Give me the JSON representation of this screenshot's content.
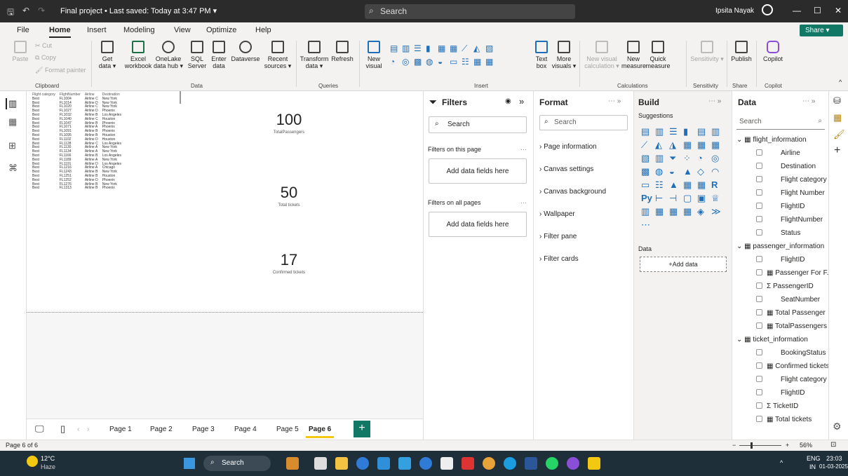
{
  "titlebar": {
    "title": "Final project • Last saved: Today at 3:47 PM ▾",
    "search": "Search",
    "user": "Ipsita Nayak"
  },
  "menu": {
    "items": [
      "File",
      "Home",
      "Insert",
      "Modeling",
      "View",
      "Optimize",
      "Help"
    ],
    "share": "Share ▾"
  },
  "ribbon": {
    "paste": "Paste",
    "cut": "Cut",
    "copy": "Copy",
    "format_painter": "Format painter",
    "get_data": "Get data ▾",
    "excel": "Excel workbook",
    "onelake": "OneLake data hub ▾",
    "sql": "SQL Server",
    "enter_data": "Enter data",
    "dataverse": "Dataverse",
    "recent": "Recent sources ▾",
    "transform": "Transform data ▾",
    "refresh": "Refresh",
    "new_visual": "New visual",
    "text_box": "Text box",
    "more_visuals": "More visuals ▾",
    "new_visual_calc": "New visual calculation ▾",
    "new_measure": "New measure",
    "quick_measure": "Quick measure",
    "sensitivity": "Sensitivity ▾",
    "publish": "Publish",
    "copilot": "Copilot",
    "groups": [
      "Clipboard",
      "Data",
      "Queries",
      "Insert",
      "Calculations",
      "Sensitivity",
      "Share",
      "Copilot"
    ]
  },
  "table": {
    "headers": [
      "Flight category",
      "FlightNumber",
      "Airline",
      "Destination"
    ],
    "rows": [
      [
        "Best",
        "FL1004",
        "Airline C",
        "New York"
      ],
      [
        "Best",
        "FL1014",
        "Airline D",
        "New York"
      ],
      [
        "Best",
        "FL1020",
        "Airline C",
        "New York"
      ],
      [
        "Best",
        "FL1027",
        "Airline D",
        "Phoenix"
      ],
      [
        "Best",
        "FL1032",
        "Airline B",
        "Los Angeles"
      ],
      [
        "Best",
        "FL1040",
        "Airline C",
        "Houston"
      ],
      [
        "Best",
        "FL1047",
        "Airline B",
        "Phoenix"
      ],
      [
        "Best",
        "FL1071",
        "Airline A",
        "Phoenix"
      ],
      [
        "Best",
        "FL1091",
        "Airline B",
        "Phoenix"
      ],
      [
        "Best",
        "FL1095",
        "Airline B",
        "Houston"
      ],
      [
        "Best",
        "FL1102",
        "Airline D",
        "Houston"
      ],
      [
        "Best",
        "FL1128",
        "Airline C",
        "Los Angeles"
      ],
      [
        "Best",
        "FL1130",
        "Airline A",
        "New York"
      ],
      [
        "Best",
        "FL1134",
        "Airline A",
        "New York"
      ],
      [
        "Best",
        "FL1166",
        "Airline B",
        "Los Angeles"
      ],
      [
        "Best",
        "FL1189",
        "Airline A",
        "New York"
      ],
      [
        "Best",
        "FL1191",
        "Airline D",
        "Los Angeles"
      ],
      [
        "Best",
        "FL1216",
        "Airline A",
        "Chicago"
      ],
      [
        "Best",
        "FL1243",
        "Airline B",
        "New York"
      ],
      [
        "Best",
        "FL1251",
        "Airline B",
        "Houston"
      ],
      [
        "Best",
        "FL1252",
        "Airline D",
        "Phoenix"
      ],
      [
        "Best",
        "FL1276",
        "Airline B",
        "New York"
      ],
      [
        "Best",
        "FL1313",
        "Airline B",
        "Phoenix"
      ]
    ]
  },
  "cards": [
    {
      "value": "100",
      "label": "TotalPassengers"
    },
    {
      "value": "50",
      "label": "Total tickets"
    },
    {
      "value": "17",
      "label": "Confirmed tickets"
    }
  ],
  "filters": {
    "title": "Filters",
    "search": "Search",
    "on_page": "Filters on this page",
    "on_all": "Filters on all pages",
    "add_fields": "Add data fields here"
  },
  "format": {
    "title": "Format",
    "search": "Search",
    "sections": [
      "Page information",
      "Canvas settings",
      "Canvas background",
      "Wallpaper",
      "Filter pane",
      "Filter cards"
    ]
  },
  "build": {
    "title": "Build",
    "suggestions": "Suggestions",
    "data_label": "Data",
    "add_data": "+Add data"
  },
  "data": {
    "title": "Data",
    "search": "Search",
    "tables": [
      {
        "name": "flight_information",
        "fields": [
          "Airline",
          "Destination",
          "Flight category",
          "Flight Number",
          "FlightID",
          "FlightNumber",
          "Status"
        ]
      },
      {
        "name": "passenger_information",
        "fields": [
          "FlightID",
          "Passenger For F...",
          "PassengerID",
          "SeatNumber",
          "Total Passenger",
          "TotalPassengers"
        ]
      },
      {
        "name": "ticket_information",
        "fields": [
          "BookingStatus",
          "Confirmed tickets",
          "Flight category",
          "FlightID",
          "TicketID",
          "Total tickets"
        ]
      }
    ]
  },
  "pages": {
    "tabs": [
      "Page 1",
      "Page 2",
      "Page 3",
      "Page 4",
      "Page 5",
      "Page 6"
    ],
    "active": "Page 6"
  },
  "status": {
    "page": "Page 6 of 6",
    "zoom": "56%"
  },
  "taskbar": {
    "temp": "12°C",
    "weather": "Haze",
    "search": "Search",
    "lang": "ENG",
    "region": "IN",
    "time": "23:03",
    "date": "01-03-2025"
  }
}
